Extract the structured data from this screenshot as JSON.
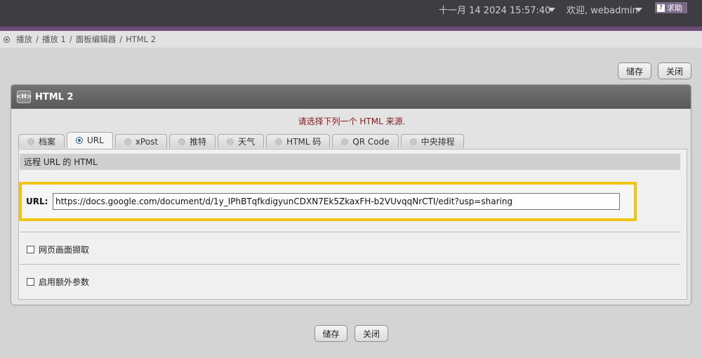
{
  "header": {
    "datetime": "十一月 14 2024 15:57:40",
    "welcome": "欢迎, webadmin",
    "help_label": "求助"
  },
  "breadcrumb": [
    "播放",
    "播放 1",
    "面板编辑器",
    "HTML 2"
  ],
  "top_buttons": {
    "save": "储存",
    "close": "关闭"
  },
  "panel": {
    "icon_text": "<H>",
    "title": "HTML 2",
    "notice": "请选择下列一个 HTML 来源.",
    "tabs": [
      {
        "label": "档案",
        "active": false
      },
      {
        "label": "URL",
        "active": true
      },
      {
        "label": "xPost",
        "active": false
      },
      {
        "label": "推特",
        "active": false
      },
      {
        "label": "天气",
        "active": false
      },
      {
        "label": "HTML 码",
        "active": false
      },
      {
        "label": "QR Code",
        "active": false
      },
      {
        "label": "中央排程",
        "active": false
      }
    ],
    "section_title": "远程 URL 的 HTML",
    "url_label": "URL:",
    "url_value": "https://docs.google.com/document/d/1y_IPhBTqfkdigyunCDXN7Ek5ZkaxFH-b2VUvqqNrCTI/edit?usp=sharing",
    "options": [
      {
        "label": "网页画面撷取",
        "checked": false
      },
      {
        "label": "启用额外参数",
        "checked": false
      }
    ]
  },
  "bottom_buttons": {
    "save": "储存",
    "close": "关闭"
  },
  "colors": {
    "topbar": "#3d3d42",
    "accent": "#6b4d75",
    "highlight": "#f1c40f",
    "notice_text": "#8a1818"
  }
}
